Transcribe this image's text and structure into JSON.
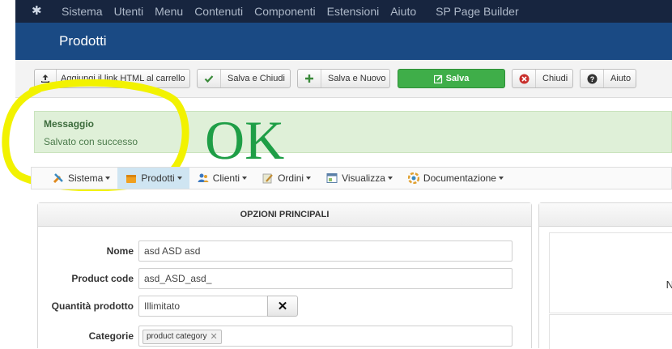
{
  "topnav": {
    "items": [
      "Sistema",
      "Utenti",
      "Menu",
      "Contenuti",
      "Componenti",
      "Estensioni",
      "Aiuto",
      "SP Page Builder"
    ]
  },
  "titlebar": {
    "title": "Prodotti"
  },
  "toolbar": {
    "add_link_label": "Aggiungi il link HTML al carrello",
    "save_close_label": "Salva e Chiudi",
    "save_new_label": "Salva e Nuovo",
    "save_label": "Salva",
    "close_label": "Chiudi",
    "help_label": "Aiuto"
  },
  "message": {
    "heading": "Messaggio",
    "text": "Salvato con successo"
  },
  "annotation": {
    "text": "OK",
    "color": "#1e9e46",
    "circle_color": "#f2f200"
  },
  "submenu": {
    "items": [
      {
        "label": "Sistema",
        "icon": "tools-icon"
      },
      {
        "label": "Prodotti",
        "icon": "box-icon",
        "active": true
      },
      {
        "label": "Clienti",
        "icon": "users-icon"
      },
      {
        "label": "Ordini",
        "icon": "pencil-icon"
      },
      {
        "label": "Visualizza",
        "icon": "window-icon"
      },
      {
        "label": "Documentazione",
        "icon": "help-icon"
      }
    ]
  },
  "panel": {
    "title": "OPZIONI PRINCIPALI",
    "fields": {
      "name_label": "Nome",
      "name_value": "asd ASD asd",
      "code_label": "Product code",
      "code_value": "asd_ASD_asd_",
      "qty_label": "Quantità prodotto",
      "qty_value": "Illimitato",
      "cat_label": "Categorie",
      "cat_tag": "product category"
    }
  },
  "side_panel": {
    "partial_text": "N"
  },
  "colors": {
    "topnav": "#17253f",
    "titlebar": "#1a4a84",
    "primary_button": "#3fae49",
    "message_bg": "#dff0d8"
  }
}
